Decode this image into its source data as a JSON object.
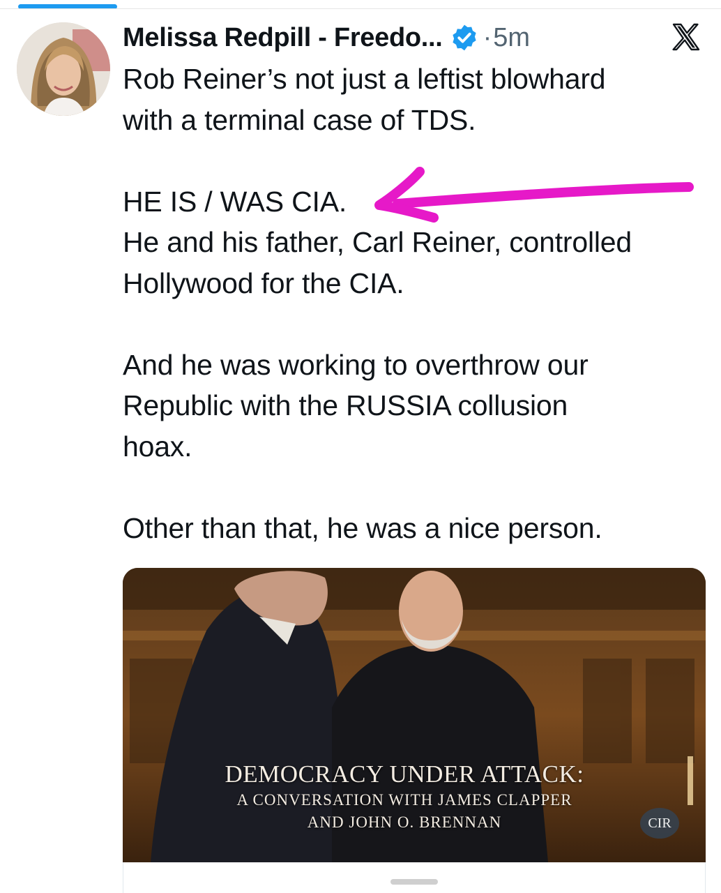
{
  "author": {
    "display_name": "Melissa Redpill - Freedo...",
    "verified_icon": "verified-badge-icon",
    "time_separator": "·",
    "time_ago": "5m"
  },
  "platform_icon": "x-logo-icon",
  "tweet": {
    "paragraphs": [
      [
        "Rob Reiner’s not just a leftist blowhard",
        "with a terminal case of  TDS."
      ],
      [
        "HE IS / WAS CIA.",
        "He and his father, Carl Reiner, controlled",
        "Hollywood for the CIA."
      ],
      [
        "And he was working to overthrow our",
        "Republic with the RUSSIA collusion",
        "hoax."
      ],
      [
        "Other than that, he was a nice person."
      ]
    ]
  },
  "media": {
    "caption_title": "DEMOCRACY UNDER ATTACK:",
    "caption_line1": "A CONVERSATION WITH JAMES CLAPPER",
    "caption_line2": "AND JOHN O. BRENNAN",
    "channel_badge": "CIR"
  },
  "colors": {
    "accent": "#1d9bf0",
    "annotation": "#e619c8",
    "text": "#0f1419",
    "muted": "#536471"
  }
}
